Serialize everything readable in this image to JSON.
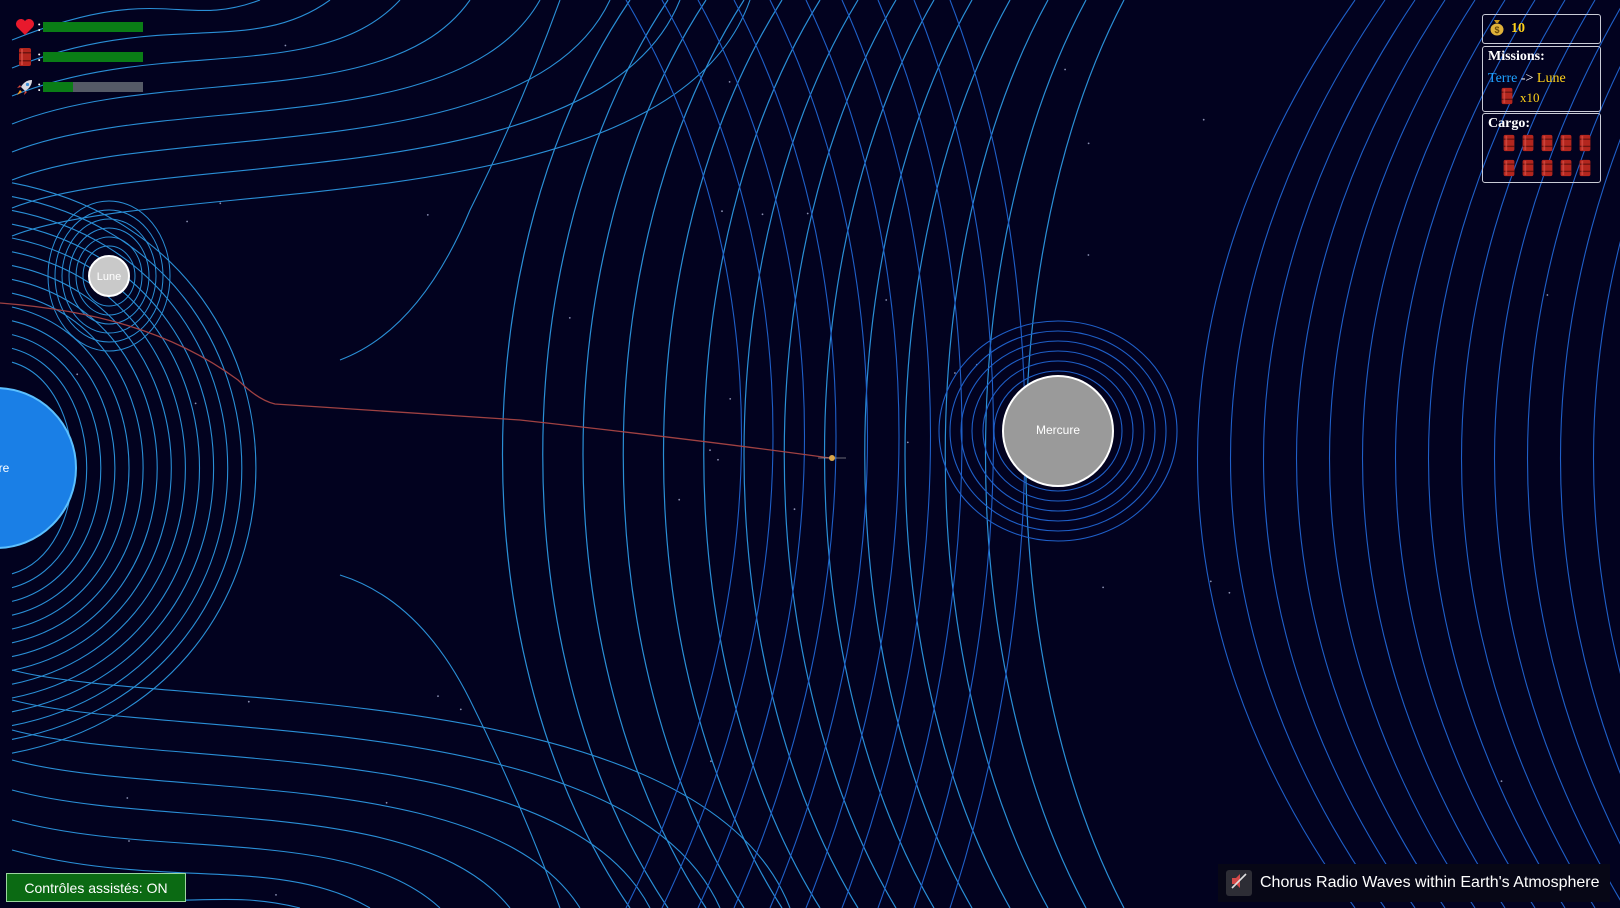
{
  "hud": {
    "health_icon": "heart-icon",
    "fuel_icon": "fuel-barrel-icon",
    "boost_icon": "rocket-icon",
    "separator": ":",
    "health_level": 1.0,
    "fuel_level": 1.0,
    "boost_level": 0.3
  },
  "money": {
    "icon": "money-bag-icon",
    "value": "10"
  },
  "missions": {
    "title": "Missions:",
    "from": "Terre",
    "arrow": "->",
    "to": "Lune",
    "quantity": "x10",
    "item_icon": "fuel-barrel-icon"
  },
  "cargo": {
    "title": "Cargo:",
    "count": 10,
    "item_icon": "fuel-barrel-icon"
  },
  "planets": [
    {
      "name": "Terre",
      "label": "re",
      "color": "#1a7fe6"
    },
    {
      "name": "Lune",
      "label": "Lune",
      "color": "#c9c9c9"
    },
    {
      "name": "Mercure",
      "label": "Mercure",
      "color": "#9a9a9a"
    }
  ],
  "assist_button": {
    "label": "Contrôles assistés: ON"
  },
  "music": {
    "title": "Chorus Radio Waves within Earth's Atmosphere",
    "mute_icon": "muted-speaker-icon"
  },
  "colors": {
    "background": "#02021f",
    "field_line_near": "#2a8fd6",
    "field_line_far": "#1f5fc8",
    "trajectory": "#a84545",
    "bar_fill": "#0a7d16",
    "gold": "#ffd21a",
    "mission_from": "#1ea1ff"
  }
}
